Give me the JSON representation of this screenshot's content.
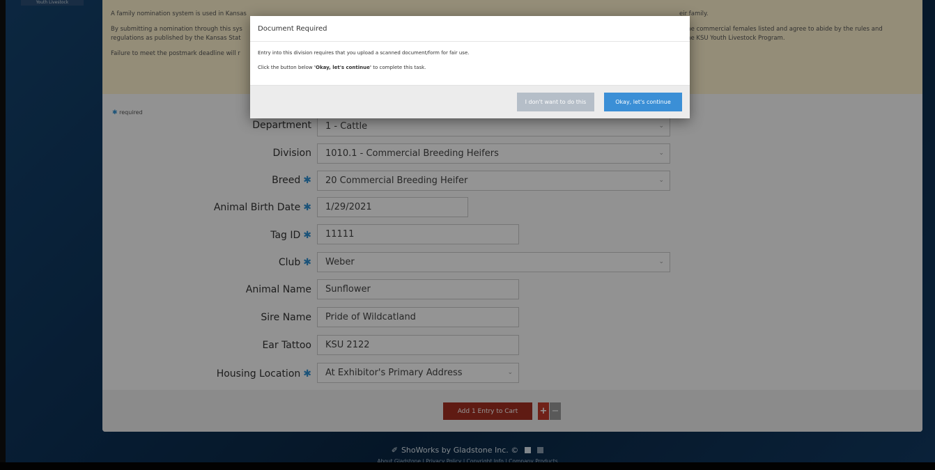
{
  "top_tag": "Youth Livestock",
  "info": {
    "p1": "A family nomination system is used in Kansas",
    "p1_right": "eir family.",
    "p2a": "By submitting a nomination through this sys",
    "p2a_right": "e the commercial females listed and agree to abide by the rules and",
    "p2b": "regulations as published by the Kansas Stat",
    "p2b_right": "y the KSU Youth Livestock Program.",
    "p3": "Failure to meet the postmark deadline will r"
  },
  "required_note": "required",
  "form": {
    "department": {
      "label": "Department",
      "value": "1 - Cattle"
    },
    "division": {
      "label": "Division",
      "value": "1010.1 - Commercial Breeding Heifers"
    },
    "breed": {
      "label": "Breed",
      "value": "20 Commercial Breeding Heifer"
    },
    "birth_date": {
      "label": "Animal Birth Date",
      "value": "1/29/2021"
    },
    "tag_id": {
      "label": "Tag ID",
      "value": "11111"
    },
    "club": {
      "label": "Club",
      "value": "Weber"
    },
    "animal_name": {
      "label": "Animal Name",
      "value": "Sunflower"
    },
    "sire_name": {
      "label": "Sire Name",
      "value": "Pride of Wildcatland"
    },
    "ear_tattoo": {
      "label": "Ear Tattoo",
      "value": "KSU 2122"
    },
    "housing": {
      "label": "Housing Location",
      "value": "At Exhibitor's Primary Address"
    }
  },
  "cart": {
    "add_label": "Add 1 Entry to Cart",
    "plus": "+",
    "minus": "−"
  },
  "footer": {
    "brand": "ShoWorks by Gladstone Inc. ©",
    "links": "About Gladstone | Privacy Policy | Copyright Info | Company Products"
  },
  "modal": {
    "title": "Document Required",
    "line1": "Entry into this division requires that you upload a scanned document/form for fair use.",
    "line2_pre": "Click the button below ",
    "line2_bold": "'Okay, let's continue'",
    "line2_post": " to complete this task.",
    "decline": "I don't want to do this",
    "accept": "Okay, let's continue"
  },
  "colors": {
    "accent": "#3b8fd6",
    "cart_button": "#a42f21",
    "required": "#2f8fd1"
  }
}
